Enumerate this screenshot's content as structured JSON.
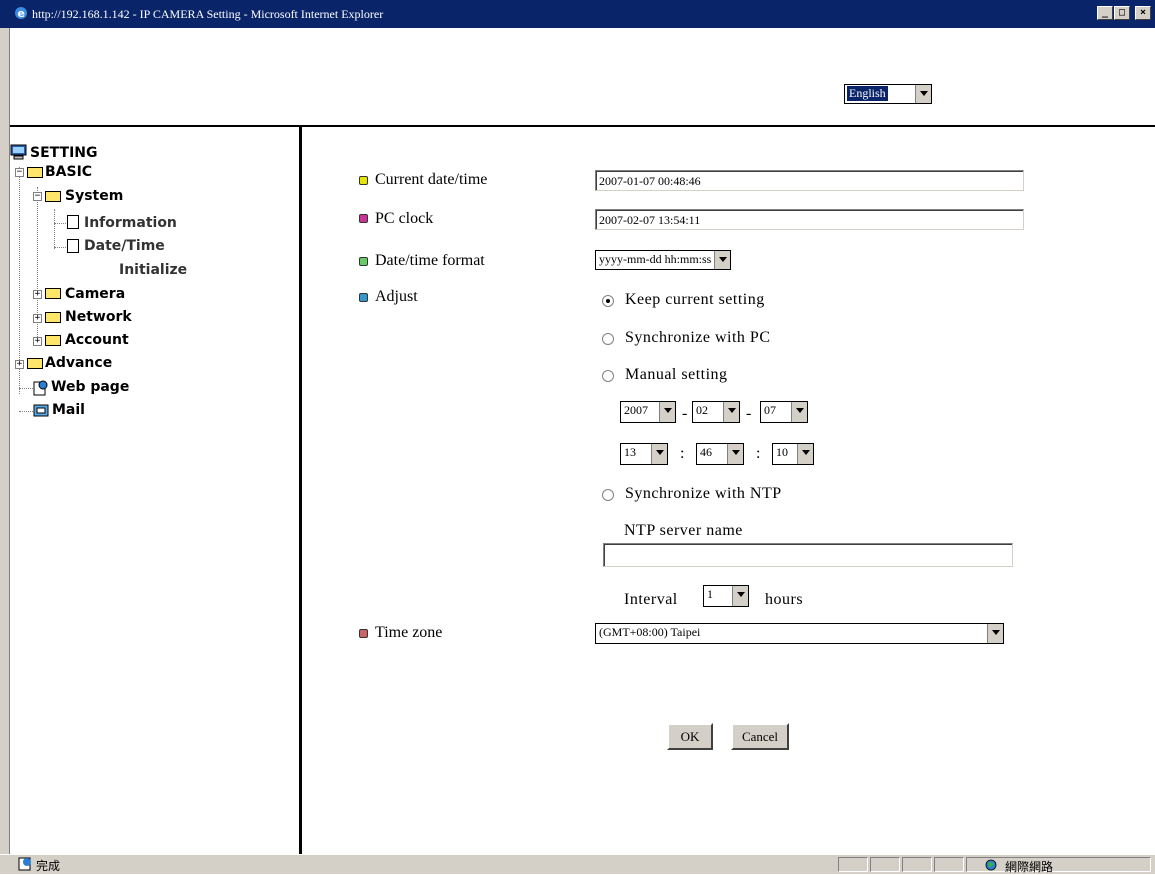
{
  "window": {
    "title": "http://192.168.1.142 - IP CAMERA Setting - Microsoft Internet Explorer",
    "minimize": "_",
    "maximize": "□",
    "close": "×"
  },
  "header": {
    "language": "English"
  },
  "nav": {
    "root": "SETTING",
    "basic": "BASIC",
    "system": "System",
    "information": "Information",
    "datetime": "Date/Time",
    "initialize": "Initialize",
    "camera": "Camera",
    "network": "Network",
    "account": "Account",
    "advance": "Advance",
    "webpage": "Web page",
    "mail": "Mail",
    "expand": "+",
    "collapse": "−"
  },
  "form": {
    "current_label": "Current date/time",
    "current_value": "2007-01-07  00:48:46",
    "pcclock_label": "PC clock",
    "pcclock_value": "2007-02-07  13:54:11",
    "format_label": "Date/time format",
    "format_value": "yyyy-mm-dd hh:mm:ss",
    "adjust_label": "Adjust",
    "opt_keep": "Keep current setting",
    "opt_sync_pc": "Synchronize with PC",
    "opt_manual": "Manual setting",
    "year": "2007",
    "month": "02",
    "day": "07",
    "hour": "13",
    "minute": "46",
    "second": "10",
    "date_sep": "-",
    "time_sep": ":",
    "opt_ntp": "Synchronize with NTP",
    "ntp_label": "NTP server name",
    "ntp_value": "",
    "interval_label": "Interval",
    "interval_value": "1",
    "interval_unit": "hours",
    "timezone_label": "Time zone",
    "timezone_value": "(GMT+08:00) Taipei",
    "ok": "OK",
    "cancel": "Cancel",
    "selected_option": "keep"
  },
  "status": {
    "text": "完成",
    "zone": "網際網路"
  },
  "colors": {
    "titlebar": "#0a246a",
    "bullet_current": "#e6e600",
    "bullet_pcclock": "#cc3399",
    "bullet_format": "#66cc66",
    "bullet_adjust": "#3399cc",
    "bullet_timezone": "#cc6666"
  }
}
